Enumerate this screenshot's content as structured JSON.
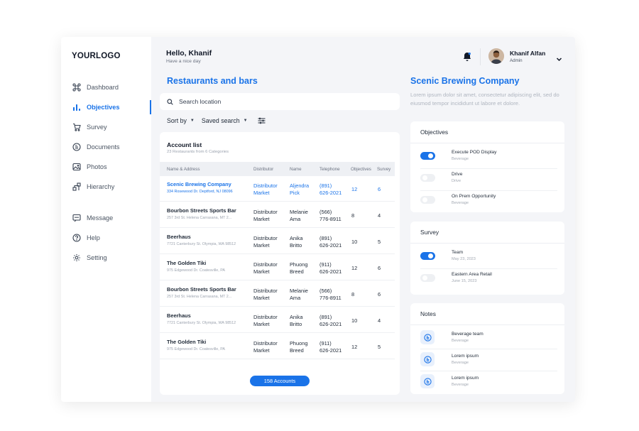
{
  "logo": "YOURLOGO",
  "nav": {
    "items": [
      {
        "label": "Dashboard",
        "icon": "command-icon"
      },
      {
        "label": "Objectives",
        "icon": "bar-chart-icon",
        "active": true
      },
      {
        "label": "Survey",
        "icon": "cart-icon"
      },
      {
        "label": "Documents",
        "icon": "document-icon"
      },
      {
        "label": "Photos",
        "icon": "photo-icon"
      },
      {
        "label": "Hierarchy",
        "icon": "hierarchy-icon"
      },
      {
        "label": "Message",
        "icon": "message-icon"
      },
      {
        "label": "Help",
        "icon": "help-icon"
      },
      {
        "label": "Setting",
        "icon": "gear-icon"
      }
    ]
  },
  "header": {
    "greeting": "Hello, Khanif",
    "subgreeting": "Have a nice day",
    "user_name": "Khanif Alfan",
    "user_role": "Admin"
  },
  "main": {
    "title": "Restaurants and bars",
    "search_placeholder": "Search location",
    "sort_label": "Sort by",
    "saved_search_label": "Saved search",
    "account_list": {
      "title": "Account list",
      "subtitle": "23 Restaurants from 6 Categories",
      "columns": [
        "Name & Address",
        "Distributor",
        "Name",
        "Telephone",
        "Objectives",
        "Survey"
      ],
      "rows": [
        {
          "name": "Scenic Brewing Company",
          "address": "334 Rosewood Dr. Deptford, NJ 08096",
          "dist1": "Distributor",
          "dist2": "Market",
          "p1": "Aljendra",
          "p2": "Pick",
          "tel1": "(891)",
          "tel2": "626-2021",
          "objectives": "12",
          "survey": "6",
          "highlight": true
        },
        {
          "name": "Bourbon Streets Sports Bar",
          "address": "257 3rd St. Helena Carrasana, MT 2...",
          "dist1": "Distributor",
          "dist2": "Market",
          "p1": "Melanie",
          "p2": "Ama",
          "tel1": "(566)",
          "tel2": "776-8911",
          "objectives": "8",
          "survey": "4"
        },
        {
          "name": "Beerhaus",
          "address": "7721 Canterbury St. Olympia, WA 98512",
          "dist1": "Distributor",
          "dist2": "Market",
          "p1": "Anika",
          "p2": "Britto",
          "tel1": "(891)",
          "tel2": "626-2021",
          "objectives": "10",
          "survey": "5"
        },
        {
          "name": "The Golden Tiki",
          "address": "975 Edgewood Dr. Coatesville, PA",
          "dist1": "Distributor",
          "dist2": "Market",
          "p1": "Phuong",
          "p2": "Breed",
          "tel1": "(911)",
          "tel2": "626-2021",
          "objectives": "12",
          "survey": "6"
        },
        {
          "name": "Bourbon Streets Sports Bar",
          "address": "257 3rd St. Helena Carrasana, MT 2...",
          "dist1": "Distributor",
          "dist2": "Market",
          "p1": "Melanie",
          "p2": "Ama",
          "tel1": "(566)",
          "tel2": "776-8911",
          "objectives": "8",
          "survey": "6"
        },
        {
          "name": "Beerhaus",
          "address": "7721 Canterbury St. Olympia, WA 98512",
          "dist1": "Distributor",
          "dist2": "Market",
          "p1": "Anika",
          "p2": "Britto",
          "tel1": "(891)",
          "tel2": "626-2021",
          "objectives": "10",
          "survey": "4"
        },
        {
          "name": "The Golden Tiki",
          "address": "975 Edgewood Dr. Coatesville, PA",
          "dist1": "Distributor",
          "dist2": "Market",
          "p1": "Phuong",
          "p2": "Breed",
          "tel1": "(911)",
          "tel2": "626-2021",
          "objectives": "12",
          "survey": "5"
        }
      ],
      "accounts_button": "158 Accounts"
    }
  },
  "detail": {
    "title": "Scenic Brewing Company",
    "description": "Lorem ipsum dolor sit amet, consectetur adipiscing elit, sed do eiusmod tempor incididunt ut labore et dolore.",
    "objectives": {
      "title": "Objectives",
      "items": [
        {
          "label": "Execute POD Display",
          "sub": "Beverage",
          "on": true
        },
        {
          "label": "Drive",
          "sub": "Drive",
          "on": false
        },
        {
          "label": "On Prem Opportunity",
          "sub": "Beverage",
          "on": false
        }
      ]
    },
    "survey": {
      "title": "Survey",
      "items": [
        {
          "label": "Team",
          "sub": "May 23, 2023",
          "on": true
        },
        {
          "label": "Eastern Area Retail",
          "sub": "June 15, 2023",
          "on": false
        }
      ]
    },
    "notes": {
      "title": "Notes",
      "items": [
        {
          "label": "Beverage team",
          "sub": "Beverage"
        },
        {
          "label": "Lorem ipsum",
          "sub": "Beverage"
        },
        {
          "label": "Lorem ipsum",
          "sub": "Beverage"
        }
      ]
    }
  },
  "colors": {
    "accent": "#1a73e8",
    "background": "#f4f5f8",
    "card": "#ffffff"
  }
}
